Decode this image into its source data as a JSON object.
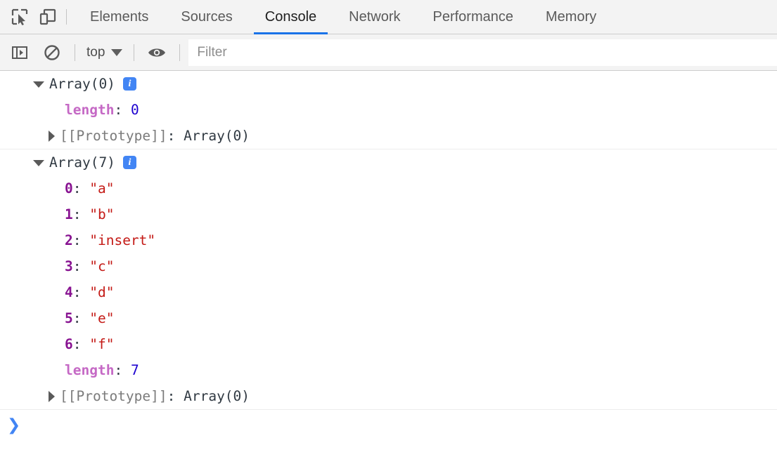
{
  "tabbar": {
    "icons": [
      {
        "name": "inspect-element-icon",
        "label": "Inspect element"
      },
      {
        "name": "device-toolbar-icon",
        "label": "Toggle device toolbar"
      }
    ],
    "tabs": [
      {
        "label": "Elements",
        "active": false
      },
      {
        "label": "Sources",
        "active": false
      },
      {
        "label": "Console",
        "active": true
      },
      {
        "label": "Network",
        "active": false
      },
      {
        "label": "Performance",
        "active": false
      },
      {
        "label": "Memory",
        "active": false
      }
    ],
    "active_tab": "Console",
    "accent_color": "#1a73e8"
  },
  "console_toolbar": {
    "sidebar_toggle_label": "Show console sidebar",
    "clear_console_label": "Clear console",
    "context_label": "top",
    "eye_label": "Live expressions",
    "filter": {
      "value": "",
      "placeholder": "Filter"
    }
  },
  "console": {
    "groups": [
      {
        "header": "Array(0)",
        "badge": "i",
        "expanded": true,
        "properties": [
          {
            "key": "length",
            "key_type": "length",
            "value": "0",
            "value_type": "number"
          }
        ],
        "prototype": {
          "key": "[[Prototype]]",
          "value": "Array(0)"
        }
      },
      {
        "header": "Array(7)",
        "badge": "i",
        "expanded": true,
        "properties": [
          {
            "key": "0",
            "key_type": "index",
            "value": "\"a\"",
            "value_type": "string"
          },
          {
            "key": "1",
            "key_type": "index",
            "value": "\"b\"",
            "value_type": "string"
          },
          {
            "key": "2",
            "key_type": "index",
            "value": "\"insert\"",
            "value_type": "string"
          },
          {
            "key": "3",
            "key_type": "index",
            "value": "\"c\"",
            "value_type": "string"
          },
          {
            "key": "4",
            "key_type": "index",
            "value": "\"d\"",
            "value_type": "string"
          },
          {
            "key": "5",
            "key_type": "index",
            "value": "\"e\"",
            "value_type": "string"
          },
          {
            "key": "6",
            "key_type": "index",
            "value": "\"f\"",
            "value_type": "string"
          },
          {
            "key": "length",
            "key_type": "length",
            "value": "7",
            "value_type": "number"
          }
        ],
        "prototype": {
          "key": "[[Prototype]]",
          "value": "Array(0)"
        }
      }
    ],
    "prompt_symbol": "❯",
    "prompt_value": ""
  },
  "colors": {
    "string_value": "#c41a16",
    "number_value": "#1c00cf",
    "index_key": "#881391",
    "length_key": "#c569c5",
    "prototype_key": "#7b7b7b",
    "badge_blue": "#4285f4"
  }
}
